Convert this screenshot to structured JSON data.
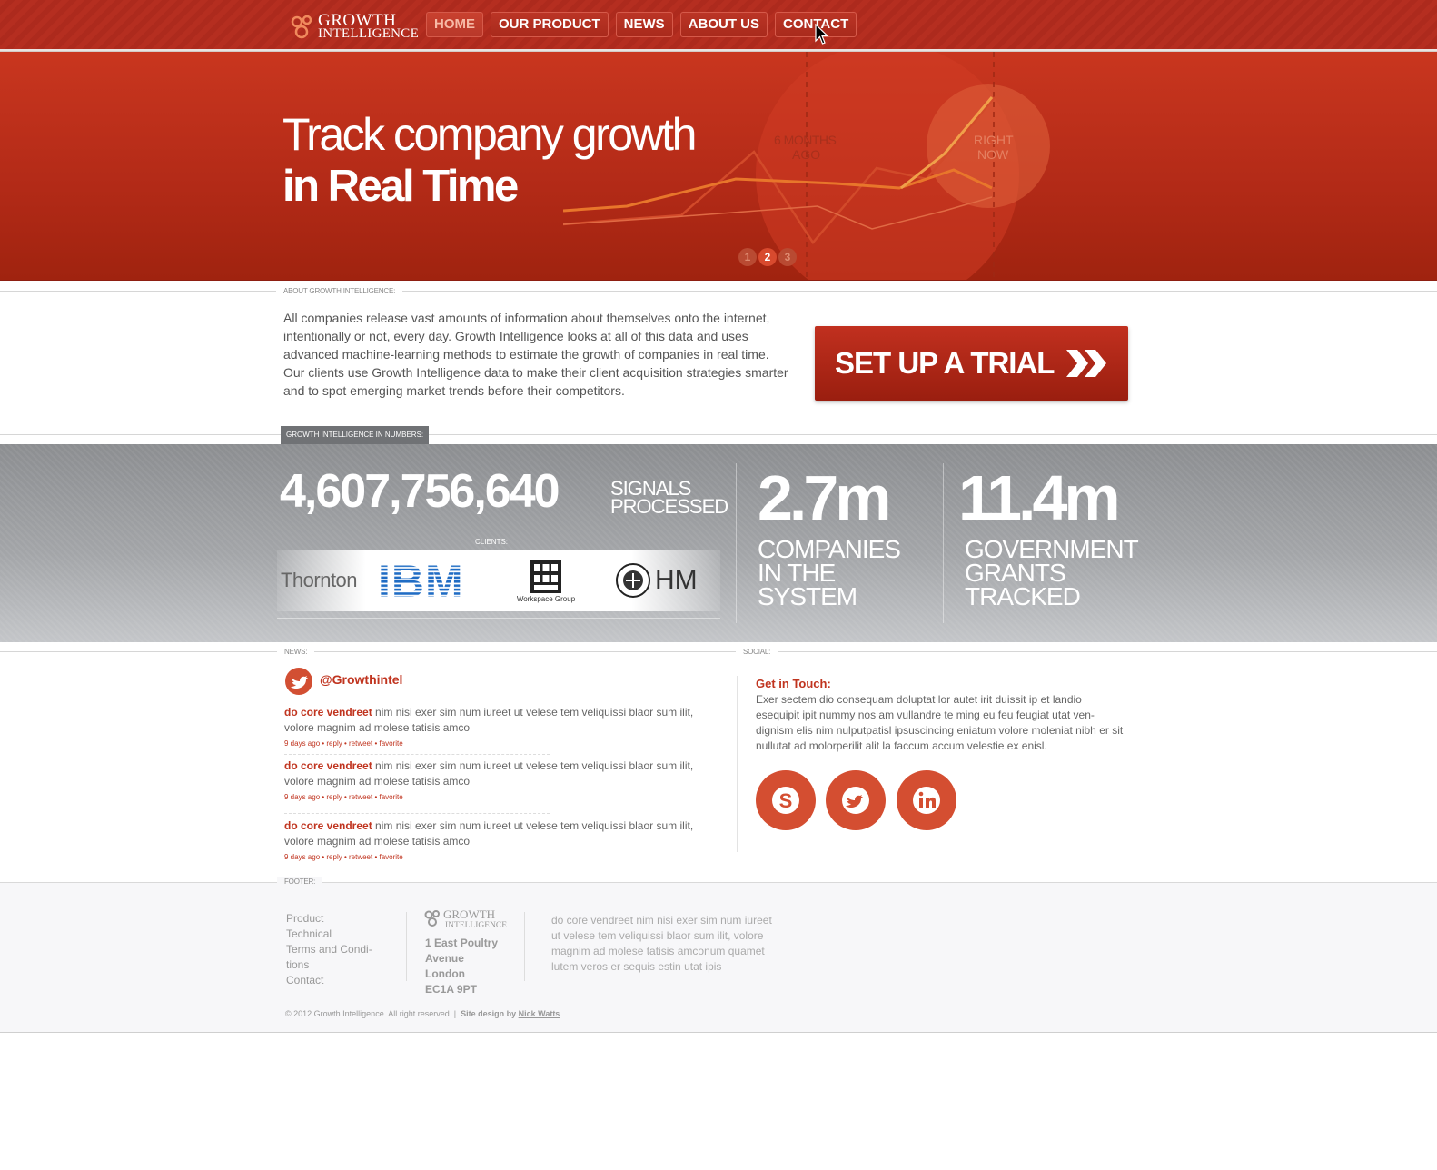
{
  "brand": {
    "line1": "GROWTH",
    "line2": "INTELLIGENCE"
  },
  "nav": [
    {
      "label": "HOME"
    },
    {
      "label": "OUR PRODUCT"
    },
    {
      "label": "NEWS"
    },
    {
      "label": "ABOUT US"
    },
    {
      "label": "CONTACT"
    }
  ],
  "hero": {
    "title_line1": "Track company growth",
    "title_line2": "in Real Time",
    "chart_label_past": "6 MONTHS AGO",
    "chart_label_now": "RIGHT NOW",
    "slides": [
      "1",
      "2",
      "3"
    ],
    "active_slide": "2"
  },
  "about": {
    "label": "ABOUT GROWTH INTELLIGENCE:",
    "text": "All companies release vast amounts of information about themselves onto the internet, intentionally or not, every day. Growth Intelligence looks at all of this data and uses advanced machine-learning methods to estimate the growth of companies in real time. Our clients use Growth Intelligence data to make their client acquisition strategies smarter and to spot emerging market trends before their competitors.",
    "trial_button": "SET UP A TRIAL"
  },
  "numbers": {
    "label": "GROWTH INTELLIGENCE IN NUMBERS:",
    "signals_value": "4,607,756,640",
    "signals_label_1": "SIGNALS",
    "signals_label_2": "PROCESSED",
    "clients_label": "CLIENTS:",
    "clients": [
      "Thornton",
      "IBM",
      "Workspace Group",
      "HM"
    ],
    "companies_value": "2.7m",
    "companies_label": [
      "COMPANIES",
      "IN THE",
      "SYSTEM"
    ],
    "grants_value": "11.4m",
    "grants_label": [
      "GOVERNMENT",
      "GRANTS",
      "TRACKED"
    ]
  },
  "news": {
    "label": "NEWS:",
    "handle": "@Growthintel",
    "tweets": [
      {
        "author": "do core vendreet",
        "text": " nim nisi exer sim num iureet ut velese tem veliquissi blaor sum ilit, volore magnim ad molese tatisis amco",
        "time": "9 days ago",
        "reply": "reply",
        "retweet": "retweet",
        "favorite": "favorite"
      },
      {
        "author": "do core vendreet",
        "text": " nim nisi exer sim num iureet ut velese tem veliquissi blaor sum ilit, volore magnim ad molese tatisis amco",
        "time": "9 days ago",
        "reply": "reply",
        "retweet": "retweet",
        "favorite": "favorite"
      },
      {
        "author": "do core vendreet",
        "text": " nim nisi exer sim num iureet ut velese tem veliquissi blaor sum ilit, volore magnim ad molese tatisis amco",
        "time": "9 days ago",
        "reply": "reply",
        "retweet": "retweet",
        "favorite": "favorite"
      }
    ]
  },
  "social": {
    "label": "SOCIAL:",
    "title": "Get in Touch:",
    "text": "Exer sectem dio consequam doluptat lor autet irit duissit ip et landio esequipit ipit nummy nos am vullandre te ming eu feu feugiat utat ven-dignism elis nim nulputpatisl ipsuscincing eniatum volore moleniat nibh er sit nullutat ad molorperilit alit la faccum accum velestie ex enisl.",
    "icons": [
      "skype-icon",
      "twitter-icon",
      "linkedin-icon"
    ]
  },
  "footer": {
    "label": "FOOTER:",
    "links": [
      "Product",
      "Technical",
      "Terms and Condi-tions",
      "Contact"
    ],
    "address": [
      "1 East Poultry",
      "Avenue",
      "London",
      "EC1A 9PT"
    ],
    "blurb": "do core vendreet nim nisi exer sim num iureet ut velese tem veliquissi blaor sum ilit, volore magnim ad molese tatisis amconum quamet lutem veros er sequis estin utat ipis",
    "copyright": "© 2012 Growth Intelligence. All right reserved",
    "separator": "|",
    "design_credit_prefix": "Site design by",
    "design_credit_name": "Nick Watts"
  },
  "colors": {
    "brand_red": "#b52e20",
    "accent_red": "#c0341f",
    "band_gray": "#9a9c9f"
  }
}
